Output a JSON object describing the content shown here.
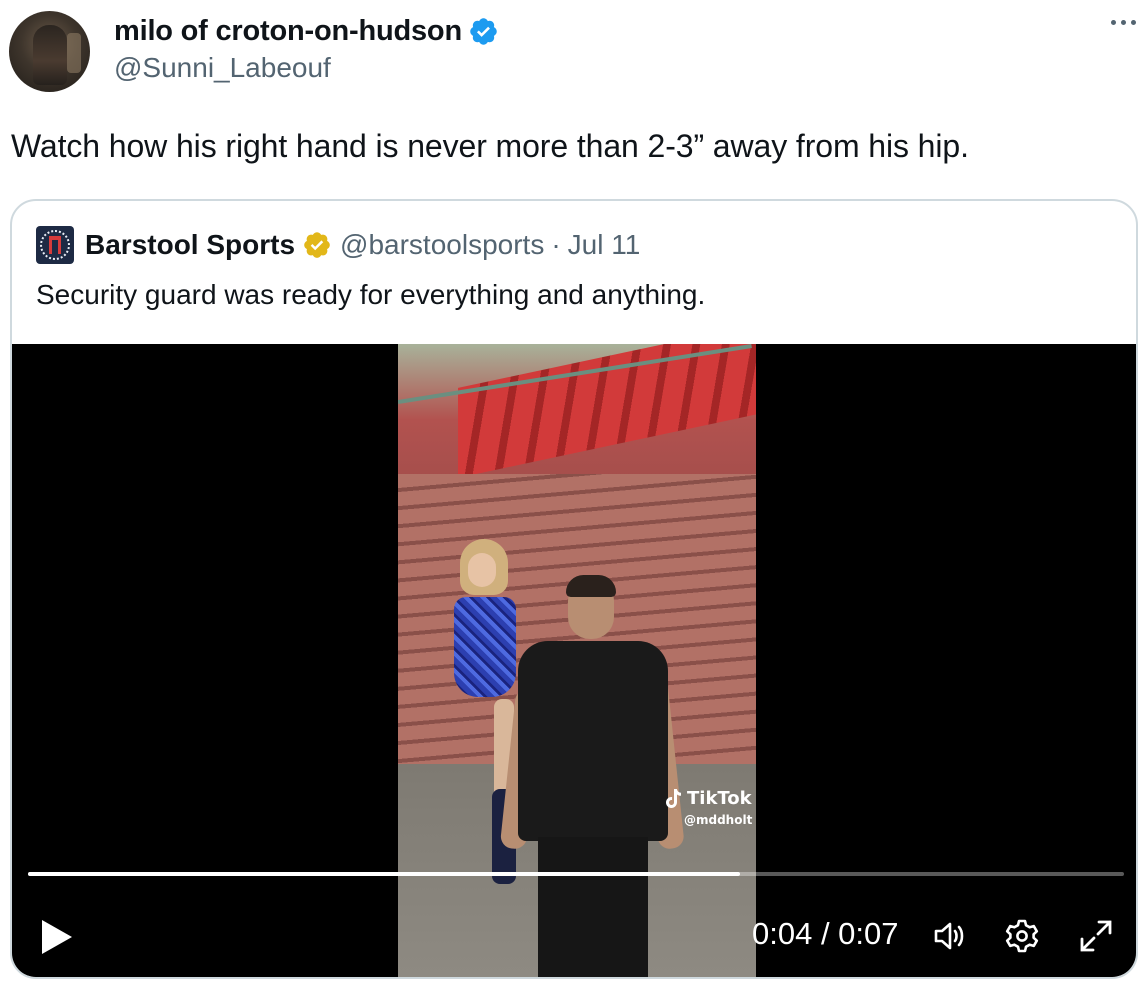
{
  "author": {
    "display_name": "milo of croton-on-hudson",
    "handle": "@Sunni_Labeouf"
  },
  "icons": {
    "verified": "verified-badge-icon",
    "more": "more-options-icon",
    "play": "play-icon",
    "volume": "volume-icon",
    "settings": "settings-gear-icon",
    "fullscreen": "fullscreen-icon",
    "tiktok": "tiktok-logo-icon"
  },
  "colors": {
    "verified_blue": "#1d9bf0",
    "verified_gold": "#e2b719",
    "muted_text": "#536471",
    "border": "#cfd9de"
  },
  "tweet_text": "Watch how his right hand is never more than 2-3” away from his hip.",
  "quoted": {
    "display_name": "Barstool Sports",
    "handle": "@barstoolsports",
    "separator": "·",
    "date": "Jul 11",
    "text": "Security guard was ready for everything and anything."
  },
  "video": {
    "watermark_brand": "TikTok",
    "watermark_user": "@mddholt",
    "time_display": "0:04 / 0:07",
    "progress_fraction": 0.65
  }
}
